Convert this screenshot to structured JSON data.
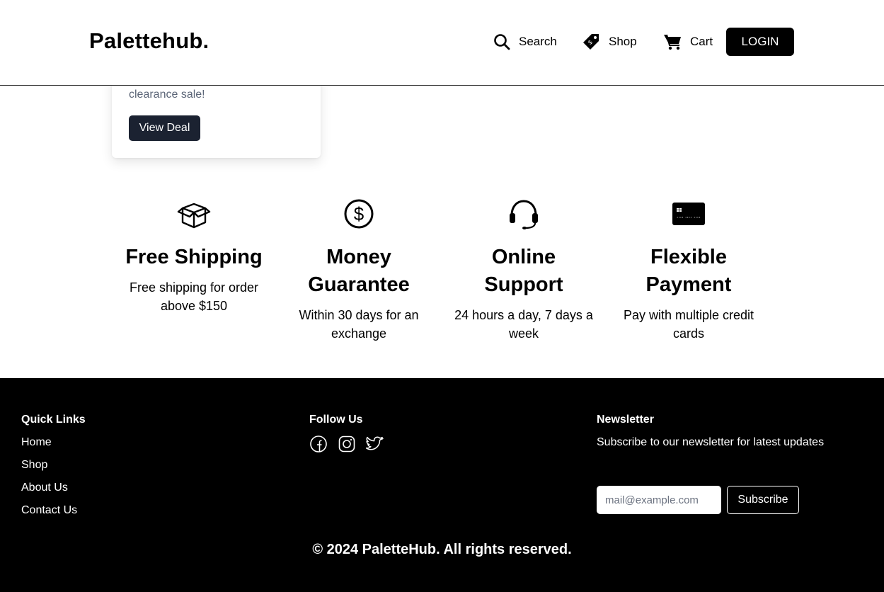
{
  "header": {
    "logo": "Palettehub.",
    "nav": {
      "search_label": "Search",
      "shop_label": "Shop",
      "cart_label": "Cart"
    },
    "login_label": "LOGIN"
  },
  "deal_card": {
    "text": "clearance sale!",
    "button_label": "View Deal"
  },
  "features": [
    {
      "icon": "box-icon",
      "title": "Free Shipping",
      "desc": "Free shipping for order above $150"
    },
    {
      "icon": "dollar-circle-icon",
      "title": "Money Guarantee",
      "desc": "Within 30 days for an exchange"
    },
    {
      "icon": "headset-icon",
      "title": "Online Support",
      "desc": "24 hours a day, 7 days a week"
    },
    {
      "icon": "credit-card-icon",
      "title": "Flexible Payment",
      "desc": "Pay with multiple credit cards"
    }
  ],
  "footer": {
    "quick_links": {
      "title": "Quick Links",
      "items": [
        "Home",
        "Shop",
        "About Us",
        "Contact Us"
      ]
    },
    "follow": {
      "title": "Follow Us",
      "icons": [
        "facebook-icon",
        "instagram-icon",
        "twitter-icon"
      ]
    },
    "newsletter": {
      "title": "Newsletter",
      "desc": "Subscribe to our newsletter for latest updates",
      "placeholder": "mail@example.com",
      "button_label": "Subscribe"
    },
    "copyright": "© 2024 PaletteHub. All rights reserved."
  },
  "colors": {
    "primary": "#000000",
    "deal_button": "#1b2231",
    "muted_text": "#5b6577",
    "background": "#ffffff"
  }
}
